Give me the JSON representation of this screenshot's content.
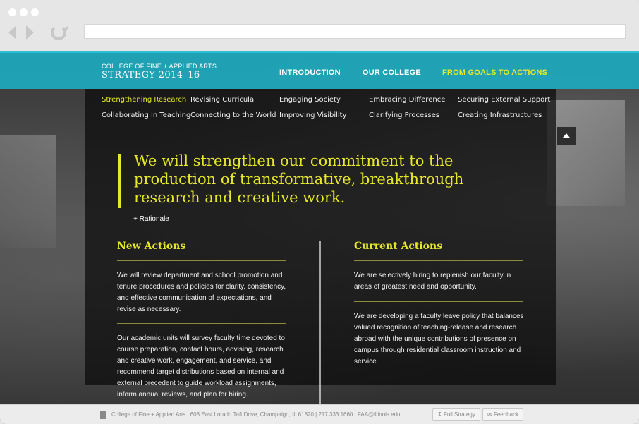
{
  "header": {
    "college": "COLLEGE OF FINE + APPLIED ARTS",
    "strategy": "STRATEGY 2014–16",
    "nav": [
      "INTRODUCTION",
      "OUR COLLEGE",
      "FROM GOALS TO ACTIONS"
    ],
    "active_nav": "FROM GOALS TO ACTIONS"
  },
  "subnav": {
    "row1": [
      "Strengthening Research",
      "Revising Curricula",
      "Engaging Society",
      "Embracing Difference",
      "Securing External Support"
    ],
    "row2": [
      "Collaborating in Teaching",
      "Connecting to the World",
      "Improving Visibility",
      "Clarifying Processes",
      "Creating Infrastructures"
    ],
    "active": "Strengthening Research"
  },
  "goal": {
    "statement": "We will strengthen our commitment to the production of transformative, breakthrough research and creative work.",
    "rationale": "+ Rationale"
  },
  "new_actions": {
    "title": "New Actions",
    "items": [
      "We will review department and school promotion and tenure procedures and policies for clarity, consistency, and effective communication of expectations, and revise as necessary.",
      "Our academic units will survey faculty time devoted to course preparation, contact hours, advising, research and creative work, engagement, and service, and recommend target distributions based on internal and external precedent to guide workload assignments, inform annual reviews, and plan for hiring."
    ]
  },
  "current_actions": {
    "title": "Current Actions",
    "items": [
      "We are selectively hiring to replenish our faculty in areas of greatest need and opportunity.",
      "We are developing a faculty leave policy that balances valued recognition of teaching-release and research abroad with the unique contributions of presence on campus through residential classroom instruction and service."
    ]
  },
  "footer": {
    "address": "College of Fine + Applied Arts | 608 East Lorado Taft Drive, Champaign, IL 61820 | 217.333.1660 | FAA@illinois.edu",
    "full_strategy": "Full Strategy",
    "feedback": "Feedback"
  },
  "colors": {
    "accent_yellow": "#e6e82a",
    "header_teal": "#1eaabe"
  }
}
